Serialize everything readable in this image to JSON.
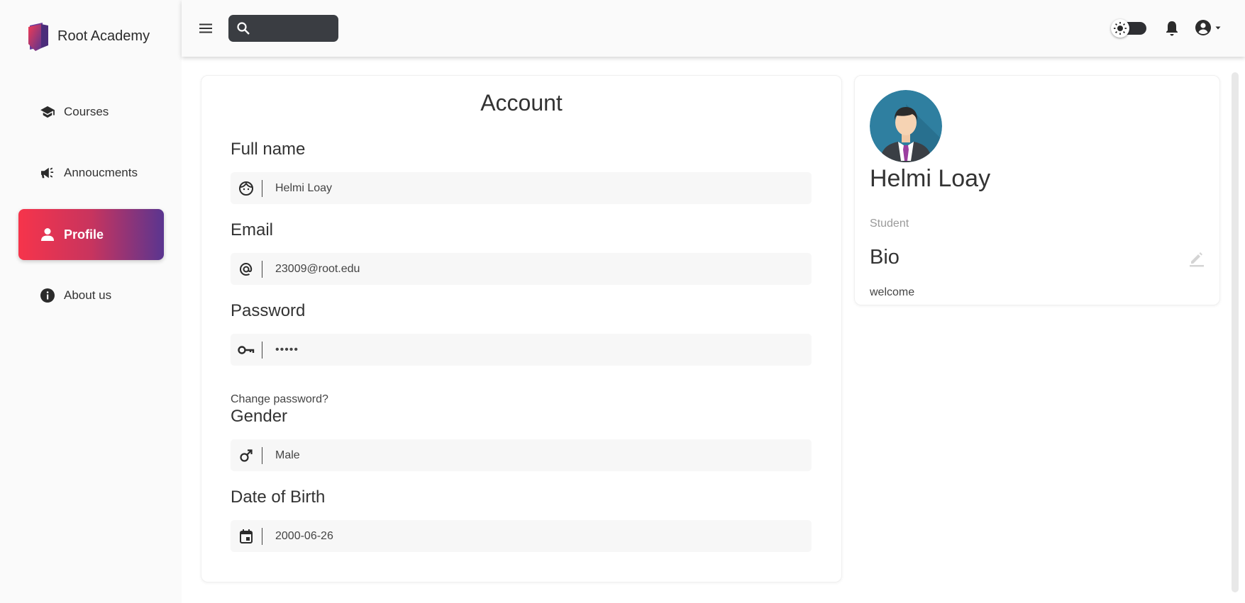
{
  "brand": {
    "name": "Root Academy",
    "logo_icon": "book-logo-icon"
  },
  "sidebar": {
    "items": [
      {
        "label": "Courses",
        "icon": "graduation-cap-icon",
        "active": false
      },
      {
        "label": "Annoucments",
        "icon": "megaphone-icon",
        "active": false
      },
      {
        "label": "Profile",
        "icon": "person-icon",
        "active": true
      },
      {
        "label": "About us",
        "icon": "info-icon",
        "active": false
      }
    ]
  },
  "topbar": {
    "menu_icon": "hamburger-menu-icon",
    "search": {
      "placeholder": "",
      "value": ""
    },
    "theme_toggle_icon": "sun-icon",
    "notifications_icon": "bell-icon",
    "account_icon": "account-circle-icon"
  },
  "account": {
    "title": "Account",
    "fields": [
      {
        "label": "Full name",
        "icon": "face-icon",
        "value": "Helmi Loay"
      },
      {
        "label": "Email",
        "icon": "at-sign-icon",
        "value": "23009@root.edu"
      },
      {
        "label": "Password",
        "icon": "key-icon",
        "value": "•••••"
      },
      {
        "label": "Gender",
        "icon": "male-icon",
        "value": "Male"
      },
      {
        "label": "Date of Birth",
        "icon": "calendar-icon",
        "value": "2000-06-26"
      }
    ],
    "change_password": "Change password?"
  },
  "profile": {
    "name": "Helmi Loay",
    "role": "Student",
    "bio_title": "Bio",
    "bio": "welcome",
    "edit_icon": "edit-pencil-icon"
  },
  "colors": {
    "active_gradient_start": "#f6344b",
    "active_gradient_end": "#5a3590",
    "search_bg": "#3a3d42"
  }
}
